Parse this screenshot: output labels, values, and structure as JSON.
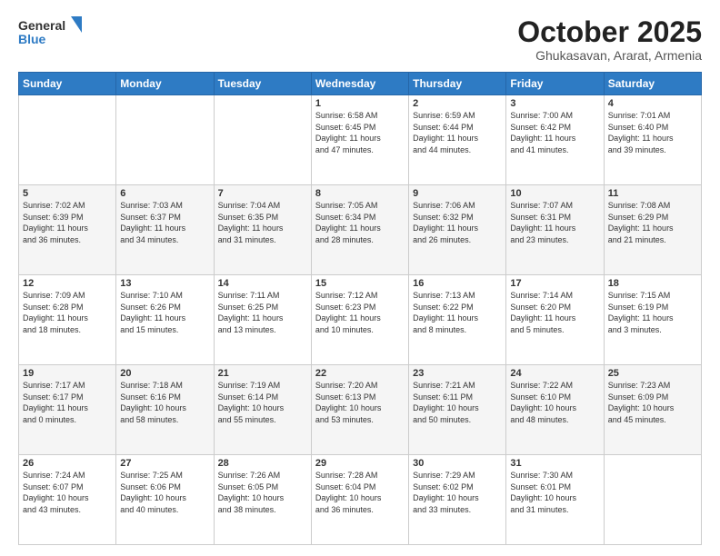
{
  "header": {
    "logo_general": "General",
    "logo_blue": "Blue",
    "month_title": "October 2025",
    "location": "Ghukasavan, Ararat, Armenia"
  },
  "days_of_week": [
    "Sunday",
    "Monday",
    "Tuesday",
    "Wednesday",
    "Thursday",
    "Friday",
    "Saturday"
  ],
  "weeks": [
    [
      {
        "day": "",
        "info": ""
      },
      {
        "day": "",
        "info": ""
      },
      {
        "day": "",
        "info": ""
      },
      {
        "day": "1",
        "info": "Sunrise: 6:58 AM\nSunset: 6:45 PM\nDaylight: 11 hours\nand 47 minutes."
      },
      {
        "day": "2",
        "info": "Sunrise: 6:59 AM\nSunset: 6:44 PM\nDaylight: 11 hours\nand 44 minutes."
      },
      {
        "day": "3",
        "info": "Sunrise: 7:00 AM\nSunset: 6:42 PM\nDaylight: 11 hours\nand 41 minutes."
      },
      {
        "day": "4",
        "info": "Sunrise: 7:01 AM\nSunset: 6:40 PM\nDaylight: 11 hours\nand 39 minutes."
      }
    ],
    [
      {
        "day": "5",
        "info": "Sunrise: 7:02 AM\nSunset: 6:39 PM\nDaylight: 11 hours\nand 36 minutes."
      },
      {
        "day": "6",
        "info": "Sunrise: 7:03 AM\nSunset: 6:37 PM\nDaylight: 11 hours\nand 34 minutes."
      },
      {
        "day": "7",
        "info": "Sunrise: 7:04 AM\nSunset: 6:35 PM\nDaylight: 11 hours\nand 31 minutes."
      },
      {
        "day": "8",
        "info": "Sunrise: 7:05 AM\nSunset: 6:34 PM\nDaylight: 11 hours\nand 28 minutes."
      },
      {
        "day": "9",
        "info": "Sunrise: 7:06 AM\nSunset: 6:32 PM\nDaylight: 11 hours\nand 26 minutes."
      },
      {
        "day": "10",
        "info": "Sunrise: 7:07 AM\nSunset: 6:31 PM\nDaylight: 11 hours\nand 23 minutes."
      },
      {
        "day": "11",
        "info": "Sunrise: 7:08 AM\nSunset: 6:29 PM\nDaylight: 11 hours\nand 21 minutes."
      }
    ],
    [
      {
        "day": "12",
        "info": "Sunrise: 7:09 AM\nSunset: 6:28 PM\nDaylight: 11 hours\nand 18 minutes."
      },
      {
        "day": "13",
        "info": "Sunrise: 7:10 AM\nSunset: 6:26 PM\nDaylight: 11 hours\nand 15 minutes."
      },
      {
        "day": "14",
        "info": "Sunrise: 7:11 AM\nSunset: 6:25 PM\nDaylight: 11 hours\nand 13 minutes."
      },
      {
        "day": "15",
        "info": "Sunrise: 7:12 AM\nSunset: 6:23 PM\nDaylight: 11 hours\nand 10 minutes."
      },
      {
        "day": "16",
        "info": "Sunrise: 7:13 AM\nSunset: 6:22 PM\nDaylight: 11 hours\nand 8 minutes."
      },
      {
        "day": "17",
        "info": "Sunrise: 7:14 AM\nSunset: 6:20 PM\nDaylight: 11 hours\nand 5 minutes."
      },
      {
        "day": "18",
        "info": "Sunrise: 7:15 AM\nSunset: 6:19 PM\nDaylight: 11 hours\nand 3 minutes."
      }
    ],
    [
      {
        "day": "19",
        "info": "Sunrise: 7:17 AM\nSunset: 6:17 PM\nDaylight: 11 hours\nand 0 minutes."
      },
      {
        "day": "20",
        "info": "Sunrise: 7:18 AM\nSunset: 6:16 PM\nDaylight: 10 hours\nand 58 minutes."
      },
      {
        "day": "21",
        "info": "Sunrise: 7:19 AM\nSunset: 6:14 PM\nDaylight: 10 hours\nand 55 minutes."
      },
      {
        "day": "22",
        "info": "Sunrise: 7:20 AM\nSunset: 6:13 PM\nDaylight: 10 hours\nand 53 minutes."
      },
      {
        "day": "23",
        "info": "Sunrise: 7:21 AM\nSunset: 6:11 PM\nDaylight: 10 hours\nand 50 minutes."
      },
      {
        "day": "24",
        "info": "Sunrise: 7:22 AM\nSunset: 6:10 PM\nDaylight: 10 hours\nand 48 minutes."
      },
      {
        "day": "25",
        "info": "Sunrise: 7:23 AM\nSunset: 6:09 PM\nDaylight: 10 hours\nand 45 minutes."
      }
    ],
    [
      {
        "day": "26",
        "info": "Sunrise: 7:24 AM\nSunset: 6:07 PM\nDaylight: 10 hours\nand 43 minutes."
      },
      {
        "day": "27",
        "info": "Sunrise: 7:25 AM\nSunset: 6:06 PM\nDaylight: 10 hours\nand 40 minutes."
      },
      {
        "day": "28",
        "info": "Sunrise: 7:26 AM\nSunset: 6:05 PM\nDaylight: 10 hours\nand 38 minutes."
      },
      {
        "day": "29",
        "info": "Sunrise: 7:28 AM\nSunset: 6:04 PM\nDaylight: 10 hours\nand 36 minutes."
      },
      {
        "day": "30",
        "info": "Sunrise: 7:29 AM\nSunset: 6:02 PM\nDaylight: 10 hours\nand 33 minutes."
      },
      {
        "day": "31",
        "info": "Sunrise: 7:30 AM\nSunset: 6:01 PM\nDaylight: 10 hours\nand 31 minutes."
      },
      {
        "day": "",
        "info": ""
      }
    ]
  ]
}
